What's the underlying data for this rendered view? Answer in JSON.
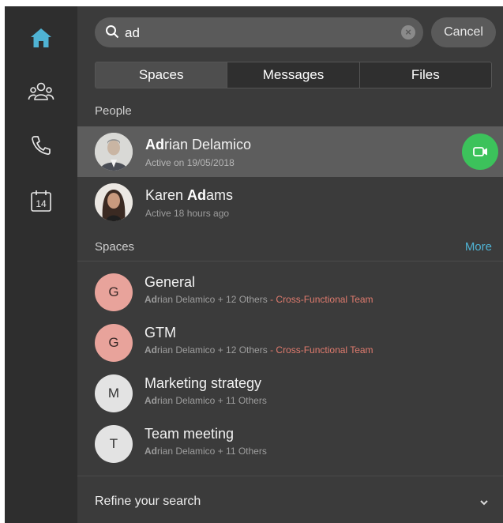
{
  "sidebar": {
    "items": [
      {
        "icon": "home-icon",
        "active": true
      },
      {
        "icon": "people-icon"
      },
      {
        "icon": "phone-icon"
      },
      {
        "icon": "calendar-icon",
        "label": "14"
      }
    ]
  },
  "search": {
    "value": "ad",
    "cancel_label": "Cancel"
  },
  "tabs": [
    {
      "label": "Spaces",
      "active": true
    },
    {
      "label": "Messages"
    },
    {
      "label": "Files"
    }
  ],
  "people": {
    "section_label": "People",
    "items": [
      {
        "name_bold": "Ad",
        "name_rest": "rian Delamico",
        "status": "Active on 19/05/2018"
      },
      {
        "name_pre": "Karen ",
        "name_bold": "Ad",
        "name_rest": "ams",
        "status": "Active 18 hours ago"
      }
    ]
  },
  "spaces": {
    "section_label": "Spaces",
    "more_label": "More",
    "items": [
      {
        "letter": "G",
        "title": "General",
        "sub_bold": "Ad",
        "sub_rest": "rian Delamico + 12 Others",
        "team": " - Cross-Functional Team",
        "color": "#e8a39b"
      },
      {
        "letter": "G",
        "title": "GTM",
        "sub_bold": "Ad",
        "sub_rest": "rian Delamico + 12 Others",
        "team": " - Cross-Functional Team",
        "color": "#e8a39b"
      },
      {
        "letter": "M",
        "title": "Marketing strategy",
        "sub_bold": "Ad",
        "sub_rest": "rian Delamico + 11 Others",
        "team": "",
        "color": "#e3e3e3"
      },
      {
        "letter": "T",
        "title": "Team meeting",
        "sub_bold": "Ad",
        "sub_rest": "rian Delamico + 11 Others",
        "team": "",
        "color": "#e3e3e3"
      }
    ]
  },
  "footer": {
    "refine_label": "Refine your search"
  },
  "colors": {
    "accent_home": "#4fb3d4",
    "call_green": "#3cc25b",
    "team_red": "#e07b6e"
  }
}
